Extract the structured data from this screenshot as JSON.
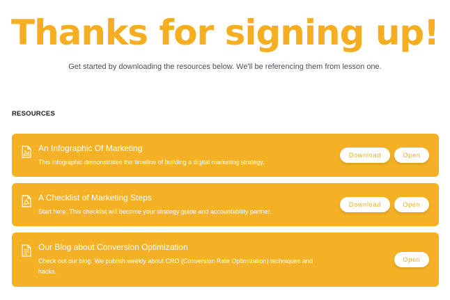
{
  "colors": {
    "accent": "#f5ae21",
    "card_bg": "#f5b126",
    "button_bg": "#ffffff",
    "button_text": "#f0ac1c",
    "subtitle_text": "#4a4f5a"
  },
  "hero": {
    "title": "Thanks for signing up!",
    "subtitle": "Get started by downloading the resources below. We'll be referencing them from lesson one."
  },
  "resources": {
    "section_label": "RESOURCES",
    "items": [
      {
        "icon": "image-file-icon",
        "title": "An Infographic Of Marketing",
        "description": "This infographic demonstrates the timeline of building a digital marketing strategy.",
        "download_label": "Download",
        "open_label": "Open"
      },
      {
        "icon": "pdf-file-icon",
        "title": "A Checklist of Marketing Steps",
        "description": "Start here. This checklist will become your strategy guide and accountability partner.",
        "download_label": "Download",
        "open_label": "Open"
      },
      {
        "icon": "document-file-icon",
        "title": "Our Blog about Conversion Optimization",
        "description": "Check out our blog. We publish weekly about CRO (Conversion Rate Optimization) techniques and hacks.",
        "open_label": "Open"
      }
    ]
  }
}
